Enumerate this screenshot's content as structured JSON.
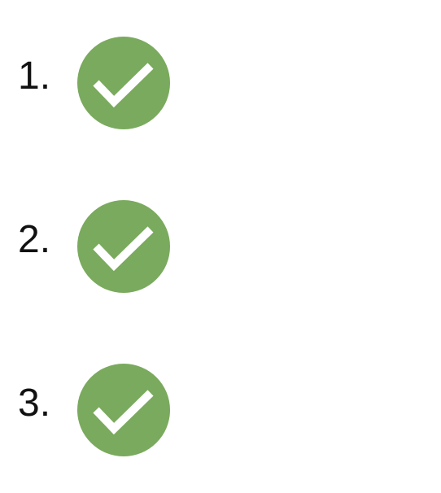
{
  "checklist": {
    "items": [
      {
        "number": "1.",
        "icon": "check-circle-icon",
        "checked": true
      },
      {
        "number": "2.",
        "icon": "check-circle-icon",
        "checked": true
      },
      {
        "number": "3.",
        "icon": "check-circle-icon",
        "checked": true
      }
    ]
  },
  "colors": {
    "check_fill": "#7aaa5d",
    "check_mark": "#ffffff",
    "text": "#111111"
  }
}
